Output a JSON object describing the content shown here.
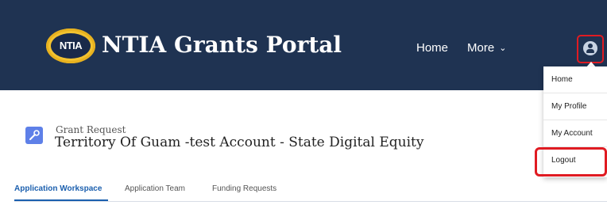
{
  "header": {
    "logo_text": "NTIA",
    "brand_title": "NTIA Grants Portal",
    "nav": {
      "home": "Home",
      "more": "More"
    }
  },
  "user_menu": {
    "items": [
      "Home",
      "My Profile",
      "My Account",
      "Logout"
    ],
    "highlighted_item": "Logout"
  },
  "record": {
    "object_label": "Grant Request",
    "title": "Territory Of Guam -test Account - State Digital Equity"
  },
  "tabs": [
    {
      "label": "Application Workspace",
      "active": true
    },
    {
      "label": "Application Team",
      "active": false
    },
    {
      "label": "Funding Requests",
      "active": false
    }
  ],
  "colors": {
    "header_bg": "#1f3352",
    "accent": "#1b5fae",
    "highlight_border": "#e01b22",
    "logo_gold": "#f2c230"
  }
}
